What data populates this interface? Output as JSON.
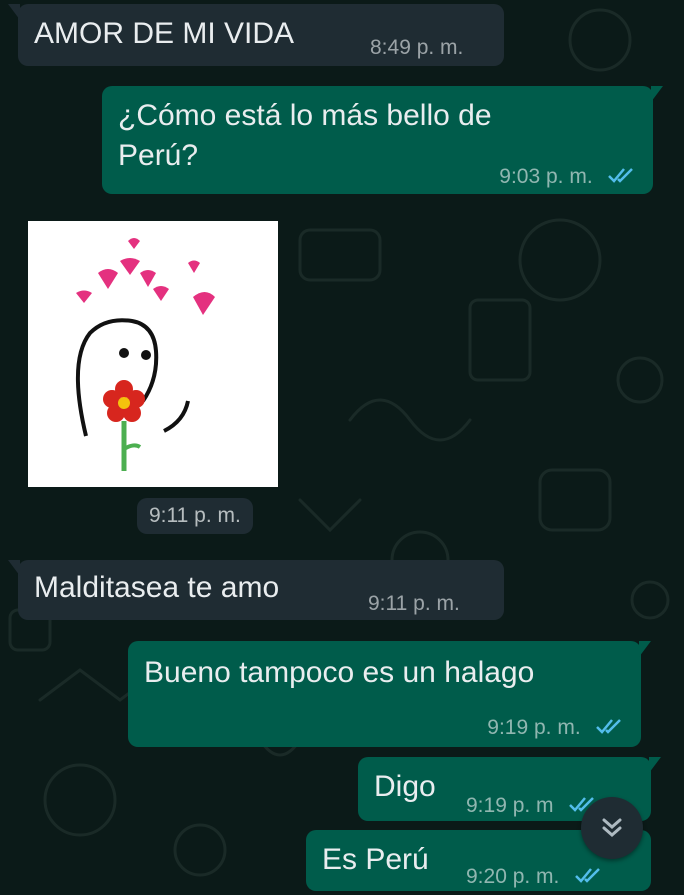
{
  "colors": {
    "background": "#0b1a18",
    "incoming_bubble": "#1f2c33",
    "outgoing_bubble": "#005c4b",
    "read_ticks": "#53bdeb",
    "heart_pink": "#e4317f",
    "flower_red": "#d7261e"
  },
  "messages": [
    {
      "direction": "incoming",
      "text": "AMOR DE MI VIDA",
      "time": "8:49 p. m."
    },
    {
      "direction": "outgoing",
      "text_line1": "¿Cómo está lo más bello de",
      "text_line2": "Perú?",
      "time": "9:03 p. m.",
      "status": "read"
    },
    {
      "direction": "incoming",
      "type": "sticker",
      "sticker": "flork-with-flower-and-hearts",
      "time": "9:11 p. m."
    },
    {
      "direction": "incoming",
      "text": "Malditasea te amo",
      "time": "9:11 p. m."
    },
    {
      "direction": "outgoing",
      "text": "Bueno tampoco es un halago",
      "time": "9:19 p. m.",
      "status": "read"
    },
    {
      "direction": "outgoing",
      "text": "Digo",
      "time": "9:19 p. m",
      "status": "read"
    },
    {
      "direction": "outgoing",
      "text": "Es Perú",
      "time": "9:20 p. m.",
      "status": "read"
    }
  ],
  "scroll_button": {
    "icon": "double-chevron-down-icon"
  }
}
